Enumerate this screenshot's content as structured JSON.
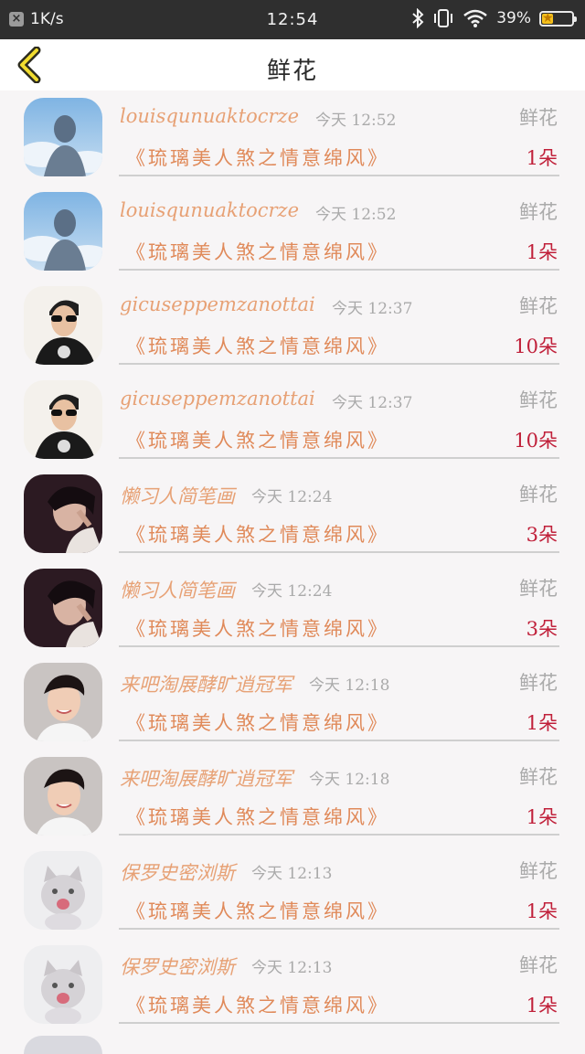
{
  "status_bar": {
    "net_speed": "1K/s",
    "time": "12:54",
    "battery": "39%",
    "battery_level": 0.39
  },
  "header": {
    "title": "鲜花"
  },
  "items": [
    {
      "name": "louisqunuaktocrze",
      "time": "今天 12:52",
      "kind": "鲜花",
      "product": "《琉璃美人煞之情意绵风》",
      "qty": "1朵",
      "avatar": "sky-woman"
    },
    {
      "name": "louisqunuaktocrze",
      "time": "今天 12:52",
      "kind": "鲜花",
      "product": "《琉璃美人煞之情意绵风》",
      "qty": "1朵",
      "avatar": "sky-woman"
    },
    {
      "name": "gicuseppemzanottai",
      "time": "今天 12:37",
      "kind": "鲜花",
      "product": "《琉璃美人煞之情意绵风》",
      "qty": "10朵",
      "avatar": "sunglasses-man"
    },
    {
      "name": "gicuseppemzanottai",
      "time": "今天 12:37",
      "kind": "鲜花",
      "product": "《琉璃美人煞之情意绵风》",
      "qty": "10朵",
      "avatar": "sunglasses-man"
    },
    {
      "name": "懒习人简笔画",
      "time": "今天 12:24",
      "kind": "鲜花",
      "product": "《琉璃美人煞之情意绵风》",
      "qty": "3朵",
      "avatar": "dark-hair"
    },
    {
      "name": "懒习人简笔画",
      "time": "今天 12:24",
      "kind": "鲜花",
      "product": "《琉璃美人煞之情意绵风》",
      "qty": "3朵",
      "avatar": "dark-hair"
    },
    {
      "name": "来吧淘展酵旷逍冠军",
      "time": "今天 12:18",
      "kind": "鲜花",
      "product": "《琉璃美人煞之情意绵风》",
      "qty": "1朵",
      "avatar": "smiling-man"
    },
    {
      "name": "来吧淘展酵旷逍冠军",
      "time": "今天 12:18",
      "kind": "鲜花",
      "product": "《琉璃美人煞之情意绵风》",
      "qty": "1朵",
      "avatar": "smiling-man"
    },
    {
      "name": "保罗史密浏斯",
      "time": "今天 12:13",
      "kind": "鲜花",
      "product": "《琉璃美人煞之情意绵风》",
      "qty": "1朵",
      "avatar": "kitten"
    },
    {
      "name": "保罗史密浏斯",
      "time": "今天 12:13",
      "kind": "鲜花",
      "product": "《琉璃美人煞之情意绵风》",
      "qty": "1朵",
      "avatar": "kitten"
    }
  ]
}
